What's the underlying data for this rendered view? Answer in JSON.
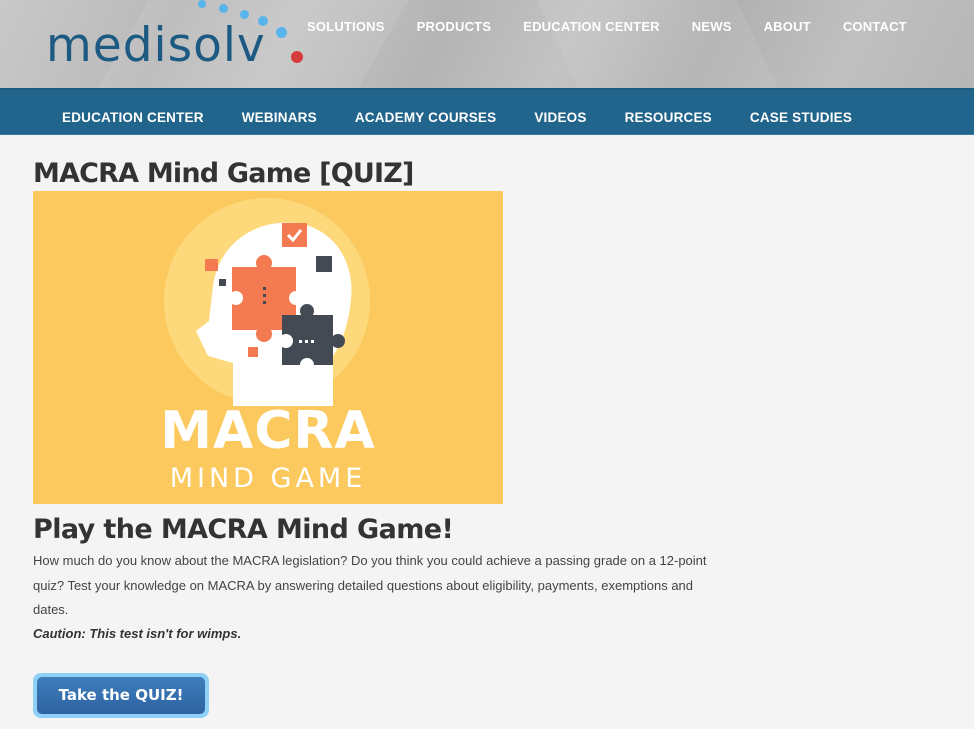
{
  "brand": {
    "name": "medisolv",
    "colors": {
      "logo": "#1c5a83",
      "dot_blue": "#5ab4ec",
      "dot_red": "#d63b3b"
    }
  },
  "top_nav": {
    "items": [
      {
        "label": "SOLUTIONS"
      },
      {
        "label": "PRODUCTS"
      },
      {
        "label": "EDUCATION CENTER"
      },
      {
        "label": "NEWS"
      },
      {
        "label": "ABOUT"
      },
      {
        "label": "CONTACT"
      }
    ]
  },
  "sub_nav": {
    "background": "#22658c",
    "items": [
      {
        "label": "EDUCATION CENTER"
      },
      {
        "label": "WEBINARS"
      },
      {
        "label": "ACADEMY COURSES"
      },
      {
        "label": "VIDEOS"
      },
      {
        "label": "RESOURCES"
      },
      {
        "label": "CASE STUDIES"
      }
    ]
  },
  "main": {
    "page_title": "MACRA Mind Game [QUIZ]",
    "hero": {
      "title": "MACRA",
      "subtitle": "MIND GAME",
      "icon": "head-puzzle-illustration",
      "colors": {
        "background": "#fcc95e",
        "circle": "#fdd97b",
        "orange": "#f47a52",
        "dark": "#434a54"
      }
    },
    "section_title": "Play the MACRA Mind Game!",
    "description": "How much do you know about the MACRA legislation? Do you think you could achieve a passing grade on a 12-point quiz? Test your knowledge on MACRA by answering detailed questions about eligibility, payments, exemptions and dates.",
    "caution": "Caution: This test isn't for wimps.",
    "cta_label": "Take the QUIZ!"
  }
}
